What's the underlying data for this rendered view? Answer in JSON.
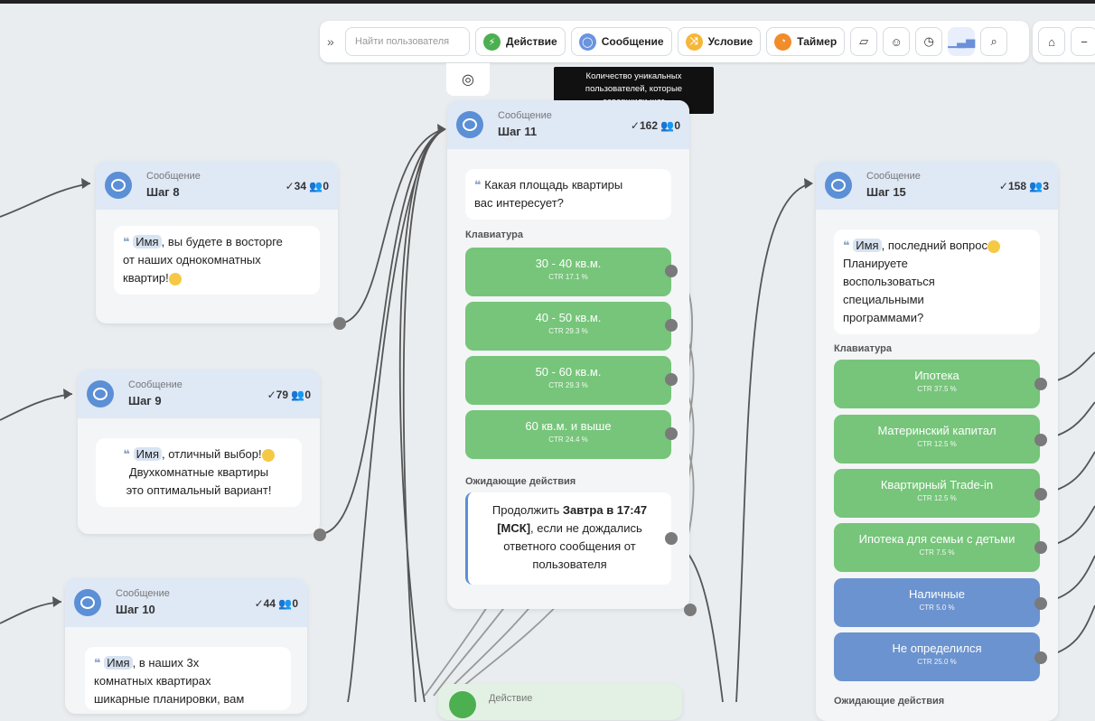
{
  "toolbar": {
    "search_placeholder": "Найти пользователя",
    "action_label": "Действие",
    "message_label": "Сообщение",
    "condition_label": "Условие",
    "timer_label": "Таймер",
    "action_color": "#4caf50",
    "message_color": "#6b93e0",
    "condition_color": "#f5b738",
    "timer_color": "#f08c2a"
  },
  "tooltip": {
    "line1": "Количество уникальных",
    "line2": "пользователей, которые",
    "line3": "завершили шаг"
  },
  "nodes": {
    "step8": {
      "type": "Сообщение",
      "name": "Шаг 8",
      "s1": "34",
      "s2": "0",
      "text": {
        "name": "Имя",
        "l1": ", вы будете в восторге",
        "l2": "от наших однокомнатных",
        "l3": "квартир!"
      }
    },
    "step9": {
      "type": "Сообщение",
      "name": "Шаг 9",
      "s1": "79",
      "s2": "0",
      "text": {
        "name": "Имя",
        "l1": ", отличный выбор!",
        "l2": "Двухкомнатные квартиры",
        "l3": "это оптимальный вариант!"
      }
    },
    "step10": {
      "type": "Сообщение",
      "name": "Шаг 10",
      "s1": "44",
      "s2": "0",
      "text": {
        "name": "Имя",
        "l1": ", в наших 3х",
        "l2": "комнатных квартирах",
        "l3": "шикарные планировки, вам"
      }
    },
    "step11": {
      "type": "Сообщение",
      "name": "Шаг 11",
      "s1": "162",
      "s2": "0",
      "text": {
        "l1": "Какая площадь квартиры",
        "l2": "вас интересует?"
      },
      "keyboard_label": "Клавиатура",
      "buttons": [
        {
          "label": "30 - 40 кв.м.",
          "ctr": "CTR 17.1 %"
        },
        {
          "label": "40 - 50 кв.м.",
          "ctr": "CTR 29.3 %"
        },
        {
          "label": "50 - 60 кв.м.",
          "ctr": "CTR 29.3 %"
        },
        {
          "label": "60 кв.м. и выше",
          "ctr": "CTR 24.4 %"
        }
      ],
      "waiting_label": "Ожидающие действия",
      "wait": {
        "pre": "Продолжить ",
        "bold": "Завтра в 17:47 [МСК]",
        "post": ", если не дождались ответного сообщения от пользователя"
      }
    },
    "step15": {
      "type": "Сообщение",
      "name": "Шаг 15",
      "s1": "158",
      "s2": "3",
      "text": {
        "name": "Имя",
        "l1": ", последний вопрос",
        "l2": "Планируете",
        "l3": "воспользоваться",
        "l4": "специальными",
        "l5": "программами?"
      },
      "keyboard_label": "Клавиатура",
      "buttons": [
        {
          "label": "Ипотека",
          "ctr": "CTR 37.5 %",
          "color": "#76c57a"
        },
        {
          "label": "Материнский капитал",
          "ctr": "CTR 12.5 %",
          "color": "#76c57a"
        },
        {
          "label": "Квартирный Trade-in",
          "ctr": "CTR 12.5 %",
          "color": "#76c57a"
        },
        {
          "label": "Ипотека для семьи с детьми",
          "ctr": "CTR 7.5 %",
          "color": "#76c57a"
        },
        {
          "label": "Наличные",
          "ctr": "CTR 5.0 %",
          "color": "#6b93cf"
        },
        {
          "label": "Не определился",
          "ctr": "CTR 25.0 %",
          "color": "#6b93cf"
        }
      ],
      "waiting_label": "Ожидающие действия"
    },
    "action": {
      "type": "Действие"
    }
  }
}
